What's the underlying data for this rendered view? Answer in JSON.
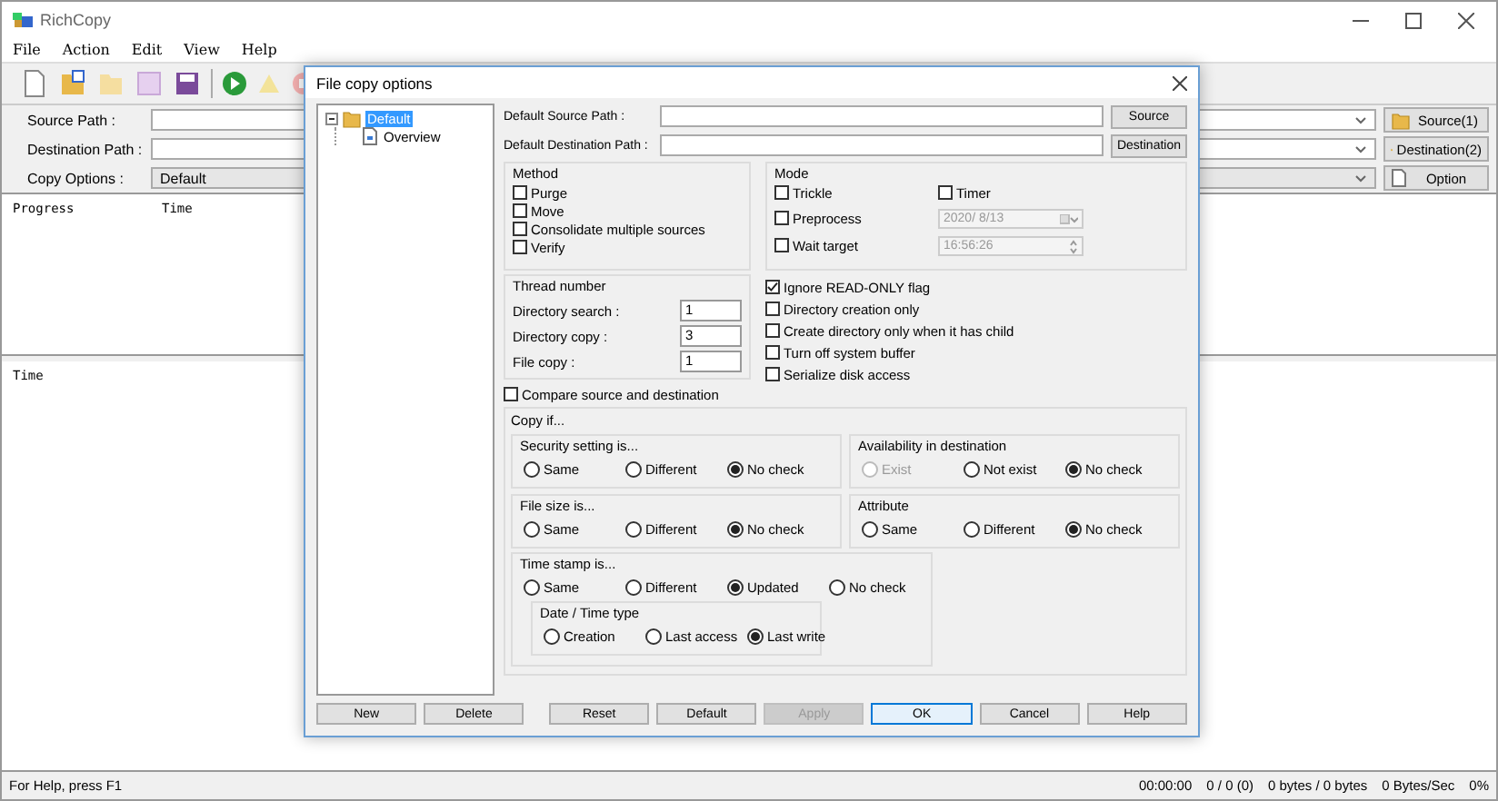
{
  "window": {
    "title": "RichCopy"
  },
  "menu": [
    "File",
    "Action",
    "Edit",
    "View",
    "Help"
  ],
  "paths": [
    {
      "label": "Source Path :",
      "button": "Source(1)",
      "kind": "field"
    },
    {
      "label": "Destination Path :",
      "button": "Destination(2)",
      "kind": "field"
    },
    {
      "label": "Copy Options :",
      "value": "Default",
      "button": "Option",
      "kind": "combo"
    }
  ],
  "progress_columns": [
    "Progress",
    "Time"
  ],
  "log_columns": [
    "Time"
  ],
  "dialog": {
    "title": "File copy options",
    "tree": [
      {
        "label": "Default",
        "selected": true,
        "expanded": true,
        "children": [
          {
            "label": "Overview",
            "selected": false
          }
        ]
      }
    ],
    "paths": [
      {
        "label": "Default Source Path :",
        "button": "Source"
      },
      {
        "label": "Default Destination Path :",
        "button": "Destination"
      }
    ],
    "method": {
      "title": "Method",
      "options": [
        {
          "label": "Purge",
          "checked": false
        },
        {
          "label": "Move",
          "checked": false
        },
        {
          "label": "Consolidate multiple sources",
          "checked": false
        },
        {
          "label": "Verify",
          "checked": false
        }
      ]
    },
    "mode": {
      "title": "Mode",
      "options": [
        {
          "label": "Trickle",
          "checked": false
        },
        {
          "label": "Preprocess",
          "checked": false
        },
        {
          "label": "Wait target",
          "checked": false
        }
      ],
      "timer": {
        "label": "Timer",
        "checked": false
      },
      "date": "2020/ 8/13",
      "time": "16:56:26"
    },
    "thread": {
      "title": "Thread number",
      "fields": [
        {
          "label": "Directory search :",
          "value": "1"
        },
        {
          "label": "Directory copy :",
          "value": "3"
        },
        {
          "label": "File copy :",
          "value": "1"
        }
      ]
    },
    "flags": [
      {
        "label": "Ignore READ-ONLY flag",
        "checked": true
      },
      {
        "label": "Directory creation only",
        "checked": false
      },
      {
        "label": "Create directory only when it has child",
        "checked": false
      },
      {
        "label": "Turn off system buffer",
        "checked": false
      },
      {
        "label": "Serialize disk access",
        "checked": false
      }
    ],
    "compare": {
      "label": "Compare source and destination",
      "checked": false
    },
    "copy_if": {
      "title": "Copy if...",
      "groups": [
        {
          "title": "Security setting is...",
          "options": [
            {
              "label": "Same",
              "selected": false,
              "disabled": false
            },
            {
              "label": "Different",
              "selected": false,
              "disabled": false
            },
            {
              "label": "No check",
              "selected": true,
              "disabled": false
            }
          ]
        },
        {
          "title": "Availability in destination",
          "options": [
            {
              "label": "Exist",
              "selected": false,
              "disabled": true
            },
            {
              "label": "Not exist",
              "selected": false,
              "disabled": false
            },
            {
              "label": "No check",
              "selected": true,
              "disabled": false
            }
          ]
        },
        {
          "title": "File size is...",
          "options": [
            {
              "label": "Same",
              "selected": false,
              "disabled": false
            },
            {
              "label": "Different",
              "selected": false,
              "disabled": false
            },
            {
              "label": "No check",
              "selected": true,
              "disabled": false
            }
          ]
        },
        {
          "title": "Attribute",
          "options": [
            {
              "label": "Same",
              "selected": false,
              "disabled": false
            },
            {
              "label": "Different",
              "selected": false,
              "disabled": false
            },
            {
              "label": "No check",
              "selected": true,
              "disabled": false
            }
          ]
        },
        {
          "title": "Time stamp is...",
          "options": [
            {
              "label": "Same",
              "selected": false,
              "disabled": false
            },
            {
              "label": "Different",
              "selected": false,
              "disabled": false
            },
            {
              "label": "Updated",
              "selected": true,
              "disabled": false
            },
            {
              "label": "No check",
              "selected": false,
              "disabled": false
            }
          ],
          "subgroup": {
            "title": "Date / Time type",
            "options": [
              {
                "label": "Creation",
                "selected": false,
                "disabled": false
              },
              {
                "label": "Last access",
                "selected": false,
                "disabled": false
              },
              {
                "label": "Last write",
                "selected": true,
                "disabled": false
              }
            ]
          }
        }
      ]
    },
    "tree_buttons": [
      {
        "label": "New",
        "disabled": false,
        "default": false
      },
      {
        "label": "Delete",
        "disabled": false,
        "default": false
      }
    ],
    "buttons": [
      {
        "label": "Reset",
        "disabled": false,
        "default": false
      },
      {
        "label": "Default",
        "disabled": false,
        "default": false
      },
      {
        "label": "Apply",
        "disabled": true,
        "default": false
      },
      {
        "label": "OK",
        "disabled": false,
        "default": true
      },
      {
        "label": "Cancel",
        "disabled": false,
        "default": false
      },
      {
        "label": "Help",
        "disabled": false,
        "default": false
      }
    ]
  },
  "status_bar": {
    "message": "For Help, press F1",
    "panes": [
      "00:00:00",
      "0 / 0 (0)",
      "0 bytes / 0 bytes",
      "0 Bytes/Sec",
      "0%"
    ]
  }
}
